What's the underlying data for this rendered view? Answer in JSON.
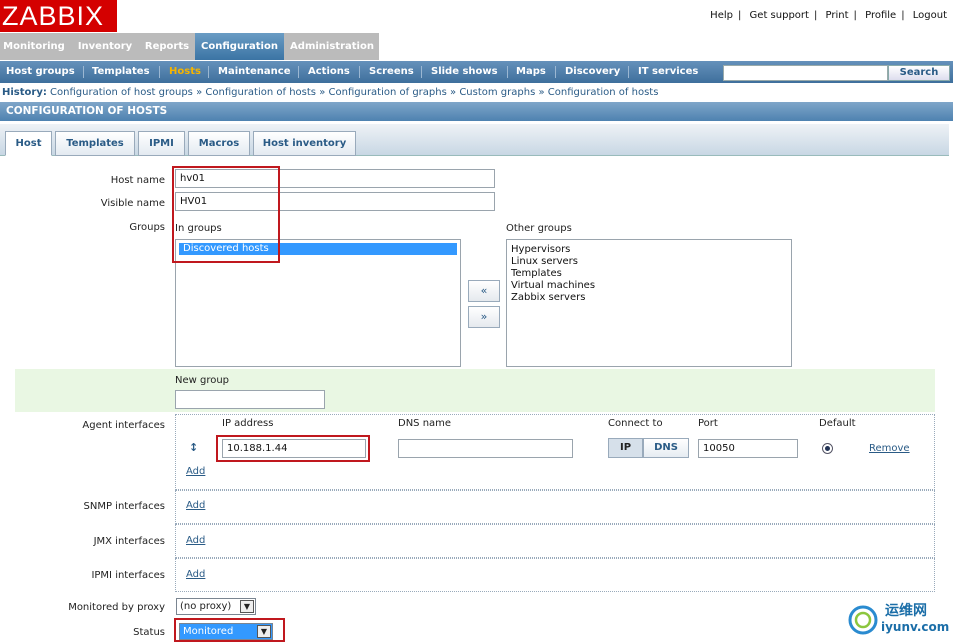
{
  "logo": "ZABBIX",
  "top_links": [
    "Help",
    "Get support",
    "Print",
    "Profile",
    "Logout"
  ],
  "main_menu": [
    "Monitoring",
    "Inventory",
    "Reports",
    "Configuration",
    "Administration"
  ],
  "sub_menu": [
    "Host groups",
    "Templates",
    "Hosts",
    "Maintenance",
    "Actions",
    "Screens",
    "Slide shows",
    "Maps",
    "Discovery",
    "IT services"
  ],
  "search": {
    "button": "Search",
    "value": ""
  },
  "history": {
    "label": "History:",
    "items": [
      "Configuration of host groups",
      "Configuration of hosts",
      "Configuration of graphs",
      "Custom graphs",
      "Configuration of hosts"
    ],
    "separator": "»"
  },
  "page_title": "CONFIGURATION OF HOSTS",
  "tabs": [
    "Host",
    "Templates",
    "IPMI",
    "Macros",
    "Host inventory"
  ],
  "form": {
    "host_name_label": "Host name",
    "host_name": "hv01",
    "visible_name_label": "Visible name",
    "visible_name": "HV01",
    "groups_label": "Groups",
    "in_groups_label": "In groups",
    "in_groups": [
      "Discovered hosts"
    ],
    "other_groups_label": "Other groups",
    "other_groups": [
      "Hypervisors",
      "Linux servers",
      "Templates",
      "Virtual machines",
      "Zabbix servers"
    ],
    "move_left": "«",
    "move_right": "»",
    "new_group_label": "New group",
    "new_group": "",
    "agent_interfaces_label": "Agent interfaces",
    "if_headers": {
      "ip": "IP address",
      "dns": "DNS name",
      "connect": "Connect to",
      "port": "Port",
      "default": "Default"
    },
    "agent_ip": "10.188.1.44",
    "agent_dns": "",
    "connect_ip": "IP",
    "connect_dns": "DNS",
    "agent_port": "10050",
    "remove": "Remove",
    "add": "Add",
    "snmp_label": "SNMP interfaces",
    "jmx_label": "JMX interfaces",
    "ipmi_label": "IPMI interfaces",
    "proxy_label": "Monitored by proxy",
    "proxy_value": "(no proxy)",
    "status_label": "Status",
    "status_value": "Monitored"
  },
  "watermark": {
    "cn": "运维网",
    "site": "iyunv.com"
  },
  "colors": {
    "logo_red": "#d40000",
    "active_menu": "#4e82b0",
    "active_sub": "#f4b400",
    "highlight": "#c0181e"
  }
}
